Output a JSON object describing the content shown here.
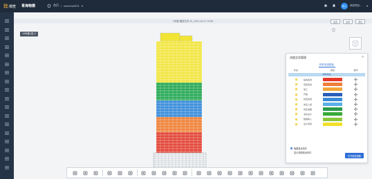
{
  "topbar": {
    "logo_mark": "比",
    "logo_text": "葆筐",
    "app_title": "青海物模",
    "breadcrumb_home": "首页",
    "breadcrumb_sep": "/",
    "breadcrumb_current": "xinzhhu2021",
    "breadcrumb_caret": "▾",
    "user_avatar": "用人",
    "user_name": "测试项目...",
    "user_caret": "▾",
    "icons": [
      "star-icon",
      "bell-icon",
      "user-icon"
    ]
  },
  "sidebar": {
    "items": [
      "menu-1",
      "menu-2",
      "menu-3",
      "menu-4",
      "menu-5",
      "menu-6",
      "menu-7",
      "menu-8",
      "menu-9",
      "menu-10",
      "menu-11",
      "menu-12",
      "menu-13",
      "menu-14",
      "menu-15",
      "menu-16",
      "menu-17",
      "menu-18"
    ]
  },
  "viewer": {
    "title": "1号楼 模型文件 01_2021-04-07 13:56",
    "actions": [
      "设置",
      "全屏",
      "退出"
    ],
    "floor_badge": "15号楼1层 ⊡",
    "building_colors": {
      "yellow": "#f1e434",
      "green": "#1aa34a",
      "blue": "#2f85d8",
      "orange": "#ef7a2b",
      "red": "#e23a2a",
      "frame": "#9aa2ab"
    }
  },
  "panel": {
    "title": "进度总览管理",
    "close": "×",
    "tab": "构件状态颜色",
    "headers": [
      "状态",
      "颜色",
      "操作"
    ],
    "selected_row": "构件状态",
    "rows": [
      {
        "name": "临电完成",
        "color": "#e8382a"
      },
      {
        "name": "安装完成",
        "color": "#f07d3a"
      },
      {
        "name": "施工",
        "color": "#f2a53a"
      },
      {
        "name": "开始",
        "color": "#2a5fb8"
      },
      {
        "name": "供应完成",
        "color": "#3a8ad8"
      },
      {
        "name": "供应入库",
        "color": "#5ab0e8"
      },
      {
        "name": "供应进程",
        "color": "#2a9a4a"
      },
      {
        "name": "深化设计",
        "color": "#3aaa3a"
      },
      {
        "name": "数据输入",
        "color": "#8ac83a"
      },
      {
        "name": "设计完成",
        "color": "#f2e02a"
      }
    ],
    "radio_options": [
      {
        "label": "隐藏其余构件",
        "checked": true
      },
      {
        "label": "显示透明其余构件",
        "checked": false
      }
    ],
    "apply_button": "打开颜色搭配"
  },
  "toolbar": {
    "tools": [
      "hand-icon",
      "up-down-icon",
      "walk-icon",
      "sep",
      "measure-icon",
      "rotate-icon",
      "rotate-left-icon",
      "sep",
      "floor-plan-icon",
      "doc-icon",
      "page-icon",
      "target-icon",
      "stack-icon",
      "sep",
      "zoom-in-icon",
      "box-zoom-icon",
      "crop-icon",
      "section-icon",
      "pan-icon",
      "layer-icon",
      "image-icon",
      "camera-icon",
      "link-icon",
      "shield-icon",
      "clipboard-icon",
      "share-icon"
    ]
  }
}
